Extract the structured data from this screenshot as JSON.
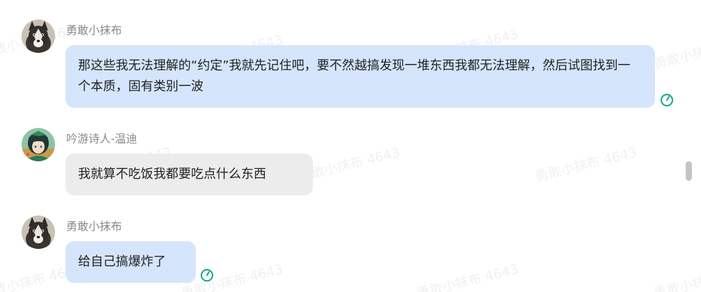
{
  "watermark_text": "勇敢小抹布 4643",
  "colors": {
    "self_bubble": "#d5e5fc",
    "other_bubble": "#ececec",
    "status_icon": "#12a58b",
    "sender_name": "#8a8a8a"
  },
  "messages": [
    {
      "sender": "勇敢小抹布",
      "avatar_icon": "husky-dog-avatar",
      "text": "那这些我无法理解的“约定”我就先记住吧，要不然越搞发现一堆东西我都无法理解，然后试图找到一个本质，固有类别一波",
      "status_icon": "read-status-clock-icon"
    },
    {
      "sender": "吟游诗人-温迪",
      "avatar_icon": "anime-character-avatar",
      "text": "我就算不吃饭我都要吃点什么东西"
    },
    {
      "sender": "勇敢小抹布",
      "avatar_icon": "husky-dog-avatar",
      "text": "给自己搞爆炸了",
      "status_icon": "read-status-clock-icon"
    }
  ]
}
